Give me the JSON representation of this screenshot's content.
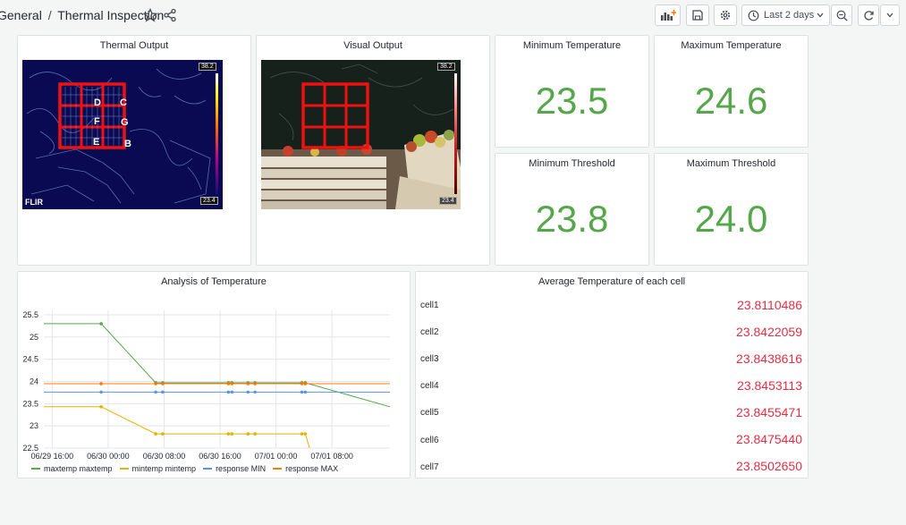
{
  "header": {
    "folder": "General",
    "separator": "/",
    "title": "Thermal Inspection",
    "time_range": "Last 2 days"
  },
  "panels": {
    "thermal": {
      "title": "Thermal Output",
      "scale_max": "38.2",
      "scale_min": "23.4",
      "logo": "FLIR",
      "cell_labels": [
        "D",
        "C",
        "F",
        "G",
        "E",
        "B"
      ]
    },
    "visual": {
      "title": "Visual Output",
      "scale_max": "38.2",
      "scale_min": "23.4"
    },
    "min_temp": {
      "title": "Minimum Temperature",
      "value": "23.5"
    },
    "max_temp": {
      "title": "Maximum Temperature",
      "value": "24.6"
    },
    "min_threshold": {
      "title": "Minimum Threshold",
      "value": "23.8"
    },
    "max_threshold": {
      "title": "Maximum Threshold",
      "value": "24.0"
    },
    "analysis": {
      "title": "Analysis of Temperature"
    },
    "average": {
      "title": "Average Temperature of each cell",
      "rows": [
        {
          "label": "cell1",
          "value": "23.8110486"
        },
        {
          "label": "cell2",
          "value": "23.8422059"
        },
        {
          "label": "cell3",
          "value": "23.8438616"
        },
        {
          "label": "cell4",
          "value": "23.8453113"
        },
        {
          "label": "cell5",
          "value": "23.8455471"
        },
        {
          "label": "cell6",
          "value": "23.8475440"
        },
        {
          "label": "cell7",
          "value": "23.8502650"
        }
      ]
    }
  },
  "colors": {
    "green": "#56a64b",
    "red": "#e02f44",
    "yellow": "#e0b400",
    "blue": "#5794f2",
    "orange": "#ff780a"
  },
  "chart_data": {
    "type": "line",
    "title": "Analysis of Temperature",
    "x_tick_labels": [
      "06/29 16:00",
      "06/30 00:00",
      "06/30 08:00",
      "06/30 16:00",
      "07/01 00:00",
      "07/01 08:00"
    ],
    "y_tick_labels": [
      "22.5",
      "23",
      "23.5",
      "24",
      "24.5",
      "25",
      "25.5"
    ],
    "ylim": [
      22.5,
      25.6
    ],
    "xlim": [
      -1.2,
      48.3
    ],
    "grid": true,
    "legend_position": "bottom",
    "series": [
      {
        "name": "maxtemp maxtemp",
        "color": "#56a64b",
        "points": [
          [
            -1.2,
            25.3
          ],
          [
            7.0,
            25.3
          ],
          [
            14.8,
            23.97
          ],
          [
            15.8,
            23.97
          ],
          [
            25.2,
            23.97
          ],
          [
            25.7,
            23.97
          ],
          [
            28.0,
            23.97
          ],
          [
            29.0,
            23.97
          ],
          [
            35.7,
            23.97
          ],
          [
            36.2,
            23.97
          ],
          [
            48.3,
            23.43
          ]
        ],
        "markers": [
          7.0,
          14.8,
          15.8,
          25.2,
          25.7,
          28.0,
          29.0,
          35.7,
          36.2
        ]
      },
      {
        "name": "mintemp mintemp",
        "color": "#e0b400",
        "points": [
          [
            -1.2,
            23.43
          ],
          [
            7.0,
            23.43
          ],
          [
            14.8,
            22.82
          ],
          [
            15.8,
            22.82
          ],
          [
            25.2,
            22.82
          ],
          [
            25.7,
            22.82
          ],
          [
            28.0,
            22.82
          ],
          [
            29.0,
            22.82
          ],
          [
            35.7,
            22.82
          ],
          [
            36.2,
            22.82
          ],
          [
            36.8,
            22.5
          ]
        ],
        "markers": [
          7.0,
          14.8,
          15.8,
          25.2,
          25.7,
          28.0,
          29.0,
          35.7,
          36.2
        ]
      },
      {
        "name": "response MIN",
        "color": "#5794f2",
        "points": [
          [
            -1.2,
            23.76
          ],
          [
            48.3,
            23.76
          ]
        ],
        "markers": [
          7.0,
          14.8,
          15.8,
          25.2,
          25.7,
          28.0,
          29.0,
          35.7,
          36.2
        ]
      },
      {
        "name": "response MAX",
        "color": "#ff780a",
        "points": [
          [
            -1.2,
            23.95
          ],
          [
            48.3,
            23.95
          ]
        ],
        "markers": [
          7.0,
          14.8,
          15.8,
          25.2,
          25.7,
          28.0,
          29.0,
          35.7,
          36.2
        ]
      }
    ]
  }
}
